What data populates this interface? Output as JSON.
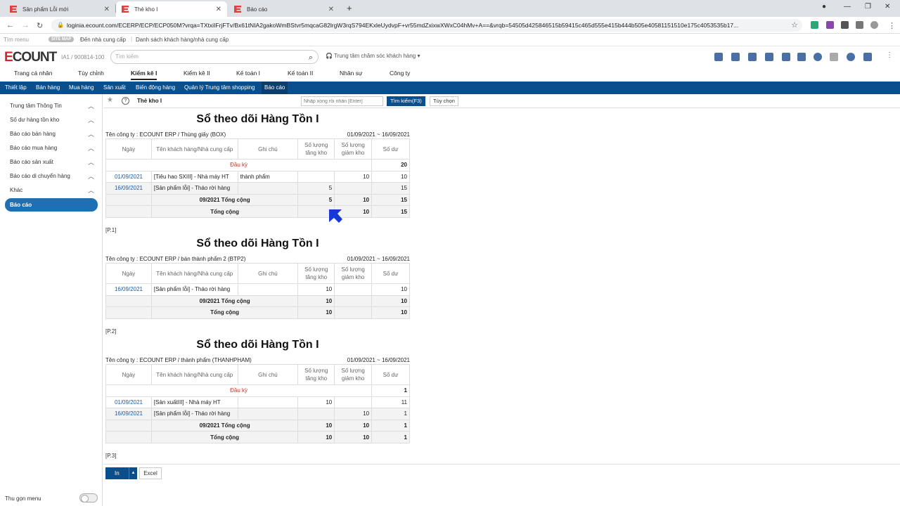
{
  "browser": {
    "tabs": [
      {
        "title": "Sản phẩm Lỗi mới"
      },
      {
        "title": "Thẻ kho I"
      },
      {
        "title": "Báo cáo"
      }
    ],
    "url": "loginia.ecount.com/ECERP/ECP/ECP050M?vrqa=TXtxiIFrjFTv/Bx61tNIA2gakoWmBStvr5mqcaG82lrgW3rqS794EKxleUydvpF+vr55mdZxixwXWxC04hMv+A==&vrqb=54505d425846515b59415c465d555e415b444b505e40581151510e175c4053535b17..."
  },
  "sitebar": {
    "menu": "Tìm menu",
    "badge": "SITE MAP",
    "link1": "Đến nhà cung cấp",
    "link2": "Danh sách khách hàng/nhà cung cấp"
  },
  "header": {
    "logo_e": "E",
    "logo_rest": "COUNT",
    "company_id": "IA1 / 900814-100",
    "search_placeholder": "Tìm kiếm",
    "support": "Trung tâm chăm sóc khách hàng"
  },
  "main_nav": [
    "Trang cá nhân",
    "Tùy chỉnh",
    "Kiểm kê I",
    "Kiểm kê II",
    "Kế toán I",
    "Kế toán II",
    "Nhân sự",
    "Công ty"
  ],
  "sub_nav": [
    "Thiết lập",
    "Bán hàng",
    "Mua hàng",
    "Sản xuất",
    "Biến động hàng",
    "Quản lý Trung tâm shopping",
    "Báo cáo"
  ],
  "sidebar": {
    "items": [
      "Trung tâm Thông Tin",
      "Số dư hàng tồn kho",
      "Báo cáo bán hàng",
      "Báo cáo mua hàng",
      "Báo cáo sản xuất",
      "Báo cáo di chuyển hàng",
      "Khác"
    ],
    "active": "Báo cáo",
    "collapse": "Thu gọn menu"
  },
  "toolbar": {
    "title": "Thẻ kho I",
    "search_placeholder": "Nhập xong rồi nhấn [Enter]",
    "search_btn": "Tìm kiếm(F3)",
    "options_btn": "Tùy chọn"
  },
  "columns": [
    "Ngày",
    "Tên khách hàng/Nhà cung cấp",
    "Ghi chú",
    "Số lượng tăng kho",
    "Số lượng giảm kho",
    "Số dư"
  ],
  "reports": [
    {
      "title": "Sổ theo dõi Hàng Tồn I",
      "company": "Tên công ty : ECOUNT ERP / Thùng giấy (BOX)",
      "date_range": "01/09/2021 ~ 16/09/2021",
      "opening": {
        "label": "Đầu kỳ",
        "balance": "20"
      },
      "rows": [
        {
          "date": "01/09/2021",
          "name": "[Tiêu hao SXIII] - Nhà máy HT",
          "note": "thành phẩm",
          "in": "",
          "out": "10",
          "bal": "10"
        },
        {
          "date": "16/09/2021",
          "name": "[Sản phẩm lỗi] - Tháo rời hàng",
          "note": "",
          "in": "5",
          "out": "",
          "bal": "15"
        }
      ],
      "subtotal": {
        "label": "09/2021 Tổng cộng",
        "in": "5",
        "out": "10",
        "bal": "15"
      },
      "total": {
        "label": "Tổng cộng",
        "in": "5",
        "out": "10",
        "bal": "15"
      },
      "page": "[P.1]"
    },
    {
      "title": "Sổ theo dõi Hàng Tồn I",
      "company": "Tên công ty : ECOUNT ERP / bán thành phẩm 2 (BTP2)",
      "date_range": "01/09/2021 ~ 16/09/2021",
      "rows": [
        {
          "date": "16/09/2021",
          "name": "[Sản phẩm lỗi] - Tháo rời hàng",
          "note": "",
          "in": "10",
          "out": "",
          "bal": "10"
        }
      ],
      "subtotal": {
        "label": "09/2021 Tổng cộng",
        "in": "10",
        "out": "",
        "bal": "10"
      },
      "total": {
        "label": "Tổng cộng",
        "in": "10",
        "out": "",
        "bal": "10"
      },
      "page": "[P.2]"
    },
    {
      "title": "Sổ theo dõi Hàng Tồn I",
      "company": "Tên công ty : ECOUNT ERP / thành phẩm (THANHPHAM)",
      "date_range": "01/09/2021 ~ 16/09/2021",
      "opening": {
        "label": "Đầu kỳ",
        "balance": "1"
      },
      "rows": [
        {
          "date": "01/09/2021",
          "name": "[Sản xuấtIII] - Nhà máy HT",
          "note": "",
          "in": "10",
          "out": "",
          "bal": "11"
        },
        {
          "date": "16/09/2021",
          "name": "[Sản phẩm lỗi] - Tháo rời hàng",
          "note": "",
          "in": "",
          "out": "10",
          "bal": "1"
        }
      ],
      "subtotal": {
        "label": "09/2021 Tổng cộng",
        "in": "10",
        "out": "10",
        "bal": "1"
      },
      "total": {
        "label": "Tổng cộng",
        "in": "10",
        "out": "10",
        "bal": "1"
      },
      "page": "[P.3]"
    }
  ],
  "footer": {
    "print": "In",
    "excel": "Excel"
  }
}
